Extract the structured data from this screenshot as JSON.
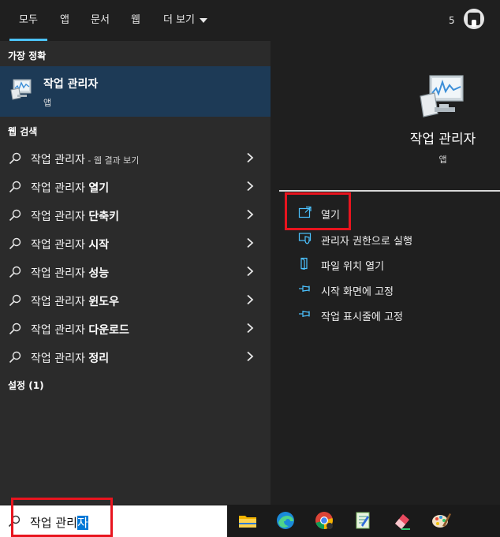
{
  "tabs": [
    {
      "label": "모두",
      "active": true
    },
    {
      "label": "앱"
    },
    {
      "label": "문서"
    },
    {
      "label": "웹"
    },
    {
      "label": "더 보기"
    }
  ],
  "header": {
    "points": "5",
    "reward_icon": "rewards-medal-icon"
  },
  "left": {
    "best_match_heading": "가장 정확",
    "best_match": {
      "title": "작업 관리자",
      "subtitle": "앱",
      "icon": "task-manager-icon"
    },
    "web_heading": "웹 검색",
    "web_results": [
      {
        "prefix": "작업 관리자",
        "bold": "",
        "suffix": " - 웹 결과 보기"
      },
      {
        "prefix": "작업 관리자 ",
        "bold": "열기",
        "suffix": ""
      },
      {
        "prefix": "작업 관리자 ",
        "bold": "단축키",
        "suffix": ""
      },
      {
        "prefix": "작업 관리자 ",
        "bold": "시작",
        "suffix": ""
      },
      {
        "prefix": "작업 관리자 ",
        "bold": "성능",
        "suffix": ""
      },
      {
        "prefix": "작업 관리자 ",
        "bold": "윈도우",
        "suffix": ""
      },
      {
        "prefix": "작업 관리자 ",
        "bold": "다운로드",
        "suffix": ""
      },
      {
        "prefix": "작업 관리자 ",
        "bold": "정리",
        "suffix": ""
      }
    ],
    "settings_heading": "설정 (1)"
  },
  "right": {
    "title": "작업 관리자",
    "subtitle": "앱",
    "actions": [
      {
        "label": "열기",
        "icon": "open-icon"
      },
      {
        "label": "관리자 권한으로 실행",
        "icon": "shield-icon"
      },
      {
        "label": "파일 위치 열기",
        "icon": "file-location-icon"
      },
      {
        "label": "시작 화면에 고정",
        "icon": "pin-icon"
      },
      {
        "label": "작업 표시줄에 고정",
        "icon": "pin-icon"
      }
    ]
  },
  "search": {
    "value": "작업 관리자",
    "typed": "작업 관리",
    "selected": "자"
  },
  "taskbar": {
    "icons": [
      "file-explorer-icon",
      "edge-icon",
      "chrome-icon",
      "notepad-plus-icon",
      "eraser-app-icon",
      "paint-icon"
    ]
  },
  "colors": {
    "accent": "#4cc2ff",
    "highlight": "#1d3a56",
    "annotation": "#e8141e",
    "selection": "#0078d7"
  }
}
